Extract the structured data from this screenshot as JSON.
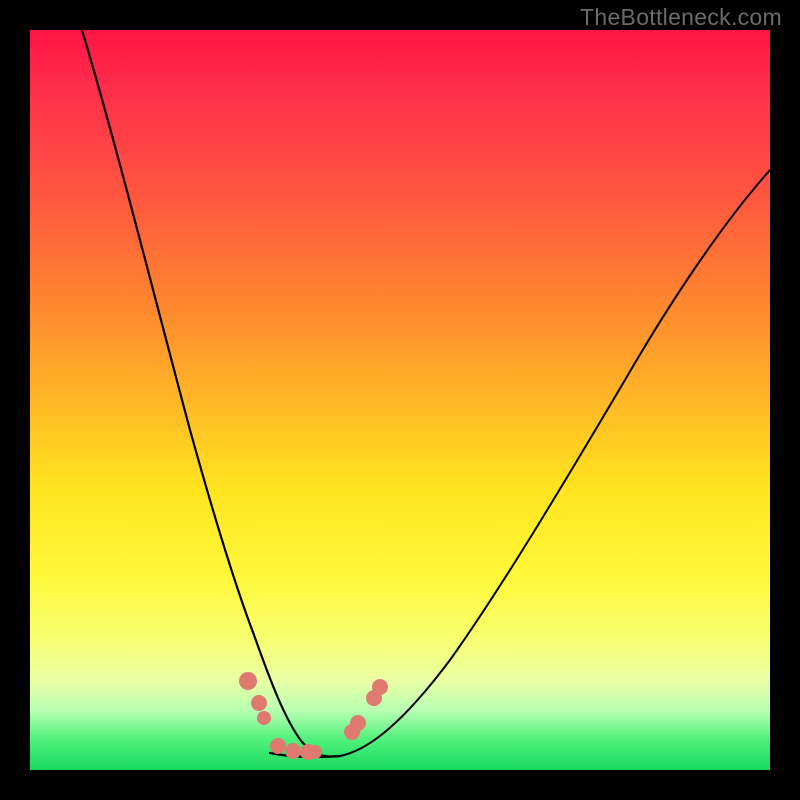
{
  "watermark": "TheBottleneck.com",
  "colors": {
    "marker_fill": "#e07a71",
    "curve_stroke": "#000000",
    "background_black": "#000000",
    "gradient_top": "#ff1445",
    "gradient_bottom": "#18d95f"
  },
  "chart_data": {
    "type": "line",
    "title": "",
    "xlabel": "",
    "ylabel": "",
    "xlim": [
      0,
      100
    ],
    "ylim": [
      0,
      100
    ],
    "grid": false,
    "legend": false,
    "description": "Two monotone curves descending from opposite top edges into a shared valley near the bottom, resembling a V-shaped bottleneck profile over a red→green vertical gradient. Salmon-colored circular markers cluster on both curves near the valley floor.",
    "series": [
      {
        "name": "left-curve",
        "x": [
          7,
          10,
          13,
          16,
          19,
          21,
          23,
          25,
          27,
          29,
          30.5,
          32,
          33.5,
          35,
          36.5,
          38,
          39.5,
          41,
          42.5
        ],
        "y": [
          100,
          90,
          80,
          70,
          60,
          52,
          45,
          38,
          31,
          25,
          21,
          17,
          13.5,
          10.5,
          8,
          6,
          4.3,
          3,
          2.3
        ]
      },
      {
        "name": "right-curve",
        "x": [
          42.5,
          45,
          48,
          52,
          56,
          61,
          66,
          72,
          78,
          84,
          90,
          96,
          100
        ],
        "y": [
          2.3,
          3.2,
          5,
          9,
          14,
          21,
          29,
          38,
          47.5,
          57,
          66,
          75,
          81
        ]
      }
    ],
    "markers": [
      {
        "series": "left-curve",
        "x": 29.5,
        "y": 12
      },
      {
        "series": "left-curve",
        "x": 31.0,
        "y": 9
      },
      {
        "series": "left-curve",
        "x": 31.8,
        "y": 7
      },
      {
        "series": "left-curve",
        "x": 33.5,
        "y": 3.3
      },
      {
        "series": "left-curve",
        "x": 35.5,
        "y": 2.6
      },
      {
        "series": "left-curve",
        "x": 37.5,
        "y": 2.4
      },
      {
        "series": "left-curve",
        "x": 38.5,
        "y": 2.35
      },
      {
        "series": "right-curve",
        "x": 43.5,
        "y": 5.2
      },
      {
        "series": "right-curve",
        "x": 44.3,
        "y": 6.3
      },
      {
        "series": "right-curve",
        "x": 46.5,
        "y": 9.8
      },
      {
        "series": "right-curve",
        "x": 47.3,
        "y": 11.2
      }
    ]
  }
}
